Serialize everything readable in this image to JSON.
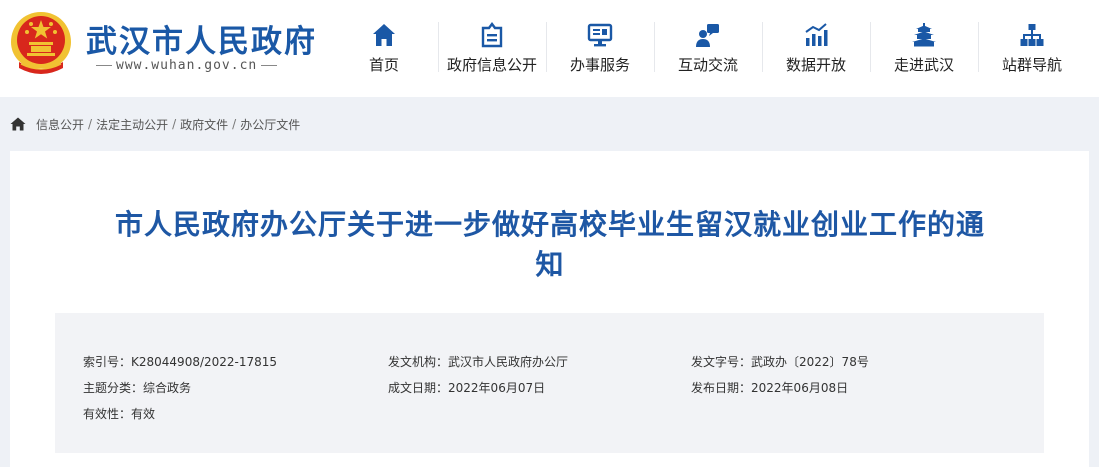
{
  "header": {
    "site_title": "武汉市人民政府",
    "site_url": "www.wuhan.gov.cn",
    "nav": [
      {
        "label": "首页",
        "icon": "home-icon"
      },
      {
        "label": "政府信息公开",
        "icon": "info-disclosure-icon"
      },
      {
        "label": "办事服务",
        "icon": "service-monitor-icon"
      },
      {
        "label": "互动交流",
        "icon": "chat-person-icon"
      },
      {
        "label": "数据开放",
        "icon": "data-chart-icon"
      },
      {
        "label": "走进武汉",
        "icon": "pavilion-icon"
      },
      {
        "label": "站群导航",
        "icon": "sitemap-icon"
      }
    ]
  },
  "breadcrumb": {
    "items": [
      "信息公开",
      "法定主动公开",
      "政府文件",
      "办公厅文件"
    ],
    "separator": "/"
  },
  "document": {
    "title": "市人民政府办公厅关于进一步做好高校毕业生留汉就业创业工作的通知",
    "meta": [
      [
        {
          "label": "索引号：",
          "value": "K28044908/2022-17815"
        },
        {
          "label": "发文机构：",
          "value": "武汉市人民政府办公厅"
        },
        {
          "label": "发文字号：",
          "value": "武政办〔2022〕78号"
        }
      ],
      [
        {
          "label": "主题分类：",
          "value": "综合政务"
        },
        {
          "label": "成文日期：",
          "value": "2022年06月07日"
        },
        {
          "label": "发布日期：",
          "value": "2022年06月08日"
        }
      ],
      [
        {
          "label": "有效性：",
          "value": "有效"
        }
      ]
    ]
  },
  "colors": {
    "brand_blue": "#1a58a6",
    "emblem_red": "#d8271c",
    "emblem_gold": "#f1c232",
    "page_bg": "#eef1f6",
    "meta_bg": "#f2f3f6"
  }
}
